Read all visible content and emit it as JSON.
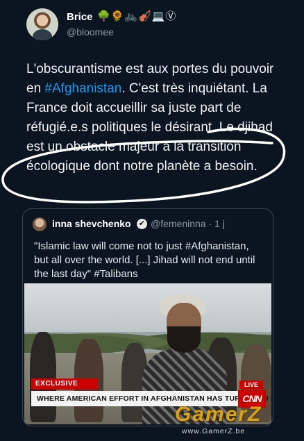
{
  "author": {
    "name": "Brice",
    "emojis": "🌳🌻🚲🎻💻Ⓥ",
    "handle": "@bloomee"
  },
  "tweet": {
    "text_before_hashtag": "L'obscurantisme est aux portes du pouvoir en ",
    "hashtag": "#Afghanistan",
    "text_after_hashtag": ". C'est très inquiétant. La France doit accueillir sa juste part de réfugié.e.s politiques le désirant. Le djihad est un obstacle majeur à la transition écologique dont notre planète a besoin."
  },
  "quoted": {
    "name": "inna shevchenko",
    "verified_icon": "✔",
    "handle_time": "@femeninna · 1 j",
    "text": "\"Islamic law will come not to just #Afghanistan, but all over the world. [...] Jihad will not end until the last day\" #Talibans",
    "media": {
      "exclusive_label": "EXCLUSIVE",
      "headline": "WHERE AMERICAN EFFORT IN AFGHANISTAN HAS TURNED TO DUST",
      "live_label": "LIVE",
      "network": "CNN"
    }
  },
  "watermark": {
    "logo": "GamerZ",
    "url": "www.GamerZ.be"
  },
  "colors": {
    "background": "#0b1521",
    "link": "#1d9bf0",
    "annotation_circle": "#ffffff"
  }
}
